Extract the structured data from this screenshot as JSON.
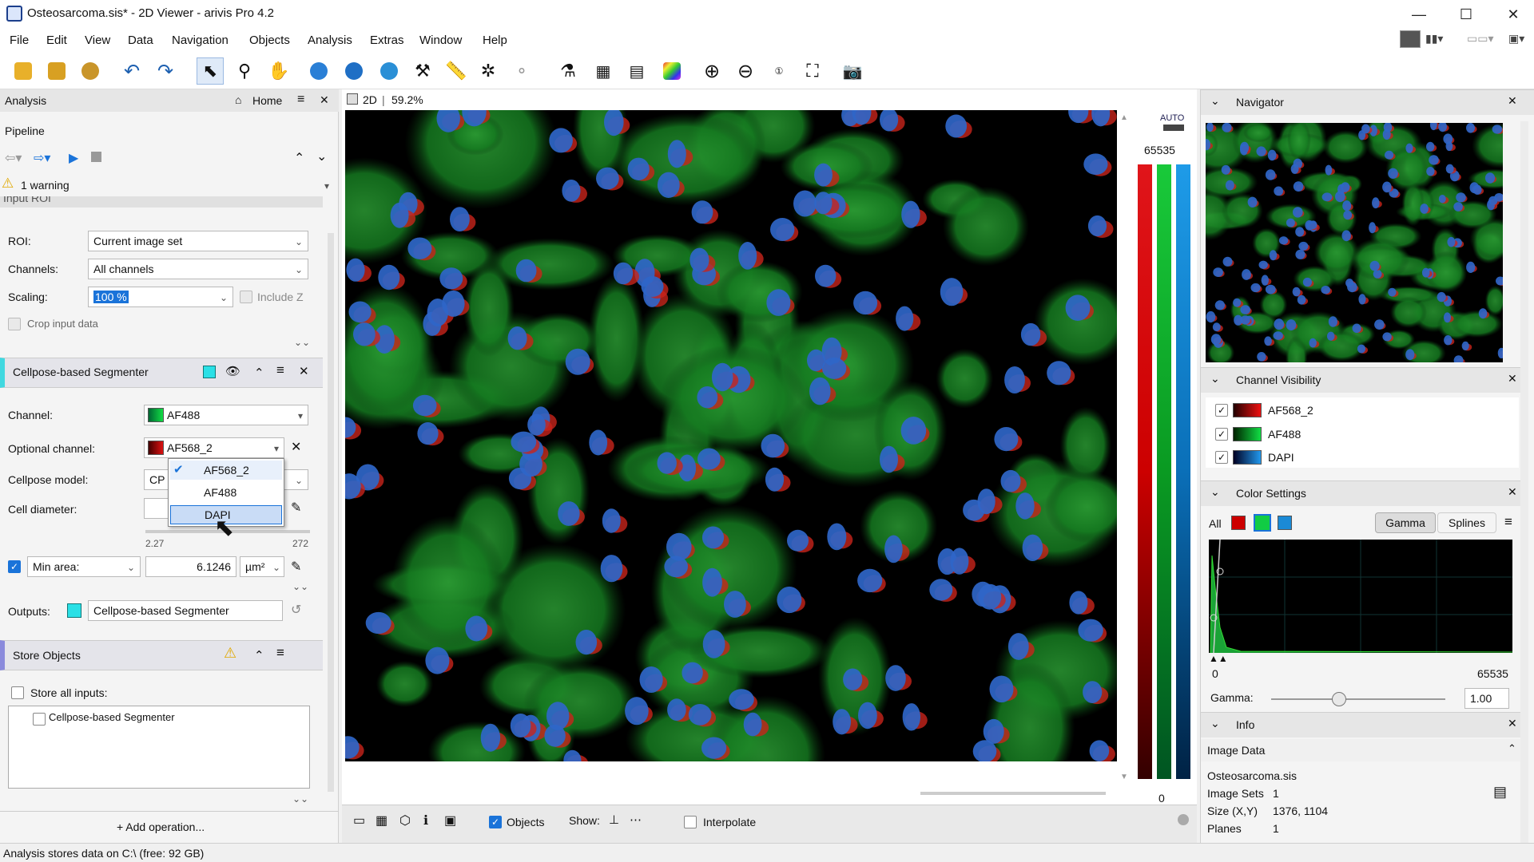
{
  "window": {
    "title": "Osteosarcoma.sis* - 2D Viewer - arivis Pro 4.2",
    "minimize": "—",
    "maximize": "☐",
    "close": "✕"
  },
  "menu": [
    "File",
    "Edit",
    "View",
    "Data",
    "Navigation",
    "Objects",
    "Analysis",
    "Extras",
    "Window",
    "Help"
  ],
  "analysis": {
    "panel_title": "Analysis",
    "home": "Home",
    "pipeline": "Pipeline",
    "warning": "1 warning",
    "input_roi": "Input ROI",
    "roi_label": "ROI:",
    "roi_value": "Current image set",
    "channels_label": "Channels:",
    "channels_value": "All channels",
    "scaling_label": "Scaling:",
    "scaling_value": "100 %",
    "include_z": "Include Z",
    "crop": "Crop input data",
    "seg_title": "Cellpose-based Segmenter",
    "channel_label": "Channel:",
    "channel_value": "AF488",
    "opt_label": "Optional channel:",
    "opt_value": "AF568_2",
    "model_label": "Cellpose model:",
    "model_value": "CP",
    "diam_label": "Cell diameter:",
    "diam_min": "2.27",
    "diam_max": "272",
    "dropdown": [
      "AF568_2",
      "AF488",
      "DAPI"
    ],
    "minarea_label": "Min area:",
    "minarea_value": "6.1246",
    "minarea_unit": "µm²",
    "outputs_label": "Outputs:",
    "outputs_value": "Cellpose-based Segmenter",
    "store_title": "Store Objects",
    "store_all": "Store all inputs:",
    "store_item": "Cellpose-based Segmenter",
    "add_op": "+ Add operation..."
  },
  "viewer": {
    "mode": "2D",
    "zoom": "59.2%",
    "lut_max": "65535",
    "lut_min": "0",
    "auto": "AUTO",
    "objects": "Objects",
    "show": "Show:",
    "interpolate": "Interpolate"
  },
  "navigator": {
    "title": "Navigator"
  },
  "channel_visibility": {
    "title": "Channel Visibility",
    "channels": [
      "AF568_2",
      "AF488",
      "DAPI"
    ]
  },
  "color_settings": {
    "title": "Color Settings",
    "all": "All",
    "gamma_btn": "Gamma",
    "splines_btn": "Splines",
    "hist_min": "0",
    "hist_max": "65535",
    "gamma_label": "Gamma:",
    "gamma_value": "1.00",
    "gamma_pos": 0.39
  },
  "info": {
    "title": "Info",
    "section": "Image Data",
    "filename": "Osteosarcoma.sis",
    "sets_label": "Image Sets",
    "sets_value": "1",
    "size_label": "Size (X,Y)",
    "size_value": "1376, 1104",
    "planes_label": "Planes",
    "planes_value": "1"
  },
  "status": "Analysis stores data on C:\\ (free: 92 GB)",
  "colors": {
    "red": "#e0151a",
    "green": "#19c93a",
    "blue": "#1e9be8",
    "accent": "#1a73d9"
  }
}
